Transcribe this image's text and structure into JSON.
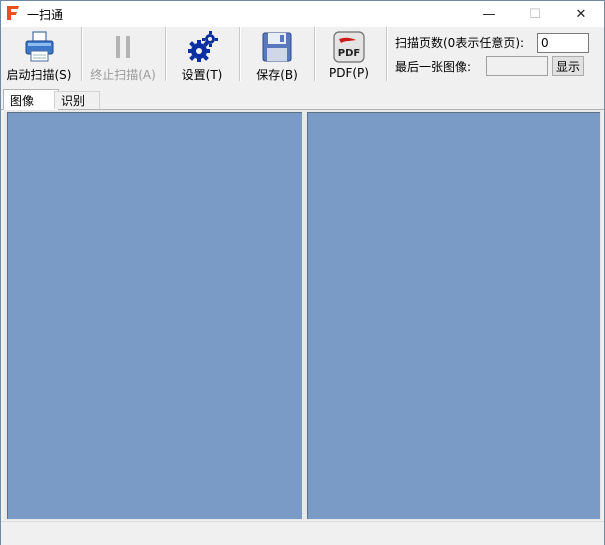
{
  "window": {
    "title": "一扫通",
    "controls": {
      "minimize": "—",
      "maximize": "☐",
      "close": "✕"
    }
  },
  "toolbar": {
    "start_scan": "启动扫描(S)",
    "stop_scan": "终止扫描(A)",
    "settings": "设置(T)",
    "save": "保存(B)",
    "pdf": "PDF(P)",
    "icons": {
      "start_scan": "scanner-icon",
      "stop_scan": "pause-icon",
      "settings": "gears-icon",
      "save": "floppy-disk-icon",
      "pdf": "pdf-icon"
    }
  },
  "options": {
    "scan_pages_label": "扫描页数(0表示任意页):",
    "scan_pages_value": "0",
    "last_image_label": "最后一张图像:",
    "last_image_value": "",
    "show_button": "显示"
  },
  "tabs": [
    {
      "label": "图像",
      "active": true
    },
    {
      "label": "识别",
      "active": false
    }
  ],
  "colors": {
    "pane_background": "#7a9bc5",
    "app_icon": "#e8501e",
    "settings_icon": "#0a2fa0"
  }
}
